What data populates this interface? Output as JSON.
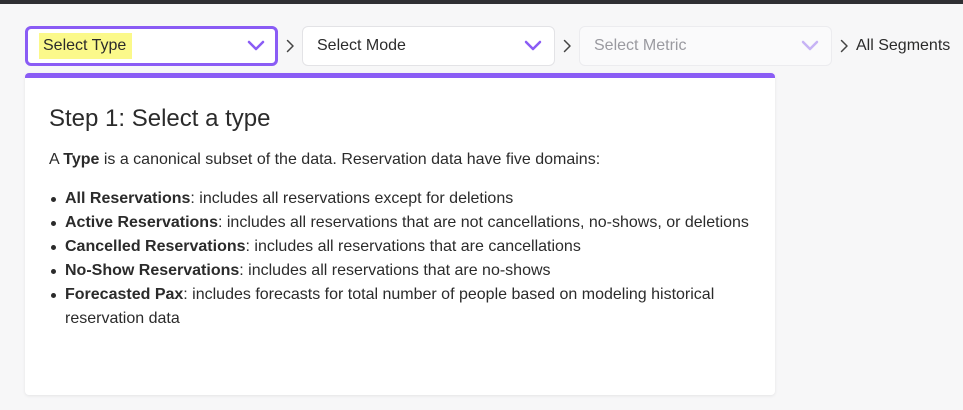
{
  "selectors": {
    "type": {
      "label": "Select Type",
      "state": "active"
    },
    "mode": {
      "label": "Select Mode",
      "state": "enabled"
    },
    "metric": {
      "label": "Select Metric",
      "state": "disabled"
    },
    "segments_label": "All Segments"
  },
  "panel": {
    "title": "Step 1: Select a type",
    "intro_prefix": "A ",
    "intro_term": "Type",
    "intro_suffix": " is a canonical subset of the data. Reservation data have five domains:",
    "items": [
      {
        "term": "All Reservations",
        "desc": ": includes all reservations except for deletions"
      },
      {
        "term": "Active Reservations",
        "desc": ": includes all reservations that are not cancellations, no-shows, or deletions"
      },
      {
        "term": "Cancelled Reservations",
        "desc": ": includes all reservations that are cancellations"
      },
      {
        "term": "No-Show Reservations",
        "desc": ": includes all reservations that are no-shows"
      },
      {
        "term": "Forecasted Pax",
        "desc": ": includes forecasts for total number of people based on modeling historical reservation data"
      }
    ]
  },
  "colors": {
    "accent": "#8a5cf5",
    "highlight": "#fbf98a",
    "chevron_disabled": "#c7b3f5"
  },
  "icons": {
    "dropdown": "chevron-down-icon",
    "separator": "chevron-right-icon"
  }
}
